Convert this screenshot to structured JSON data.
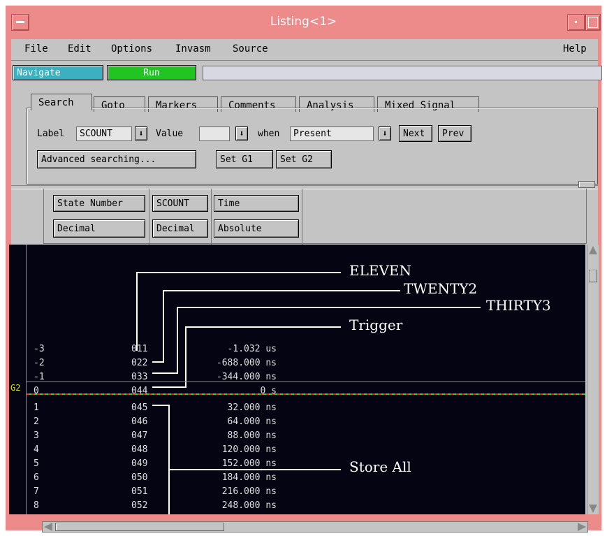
{
  "window": {
    "title": "Listing<1>"
  },
  "menubar": [
    "File",
    "Edit",
    "Options",
    "Invasm",
    "Source"
  ],
  "help_label": "Help",
  "toolbar": {
    "navigate": "Navigate",
    "run": "Run",
    "status": ""
  },
  "tabs": [
    "Search",
    "Goto",
    "Markers",
    "Comments",
    "Analysis",
    "Mixed Signal"
  ],
  "search": {
    "label_text": "Label",
    "label_value": "SCOUNT",
    "value_text": "Value",
    "value_value": "",
    "when_text": "when",
    "when_value": "Present",
    "next": "Next",
    "prev": "Prev",
    "advanced": "Advanced searching...",
    "set_g1": "Set G1",
    "set_g2": "Set G2",
    "arrow": "⬇"
  },
  "columns": [
    {
      "name": "State Number",
      "format": "Decimal"
    },
    {
      "name": "SCOUNT",
      "format": "Decimal"
    },
    {
      "name": "Time",
      "format": "Absolute"
    }
  ],
  "gutter_marker": "G2",
  "rows": [
    {
      "state": "-3",
      "scount": "011",
      "time": "-1.032 us"
    },
    {
      "state": "-2",
      "scount": "022",
      "time": "-688.000 ns"
    },
    {
      "state": "-1",
      "scount": "033",
      "time": "-344.000 ns"
    },
    {
      "state": "0",
      "scount": "044",
      "time": "0 s"
    },
    {
      "state": "1",
      "scount": "045",
      "time": "32.000 ns"
    },
    {
      "state": "2",
      "scount": "046",
      "time": "64.000 ns"
    },
    {
      "state": "3",
      "scount": "047",
      "time": "88.000 ns"
    },
    {
      "state": "4",
      "scount": "048",
      "time": "120.000 ns"
    },
    {
      "state": "5",
      "scount": "049",
      "time": "152.000 ns"
    },
    {
      "state": "6",
      "scount": "050",
      "time": "184.000 ns"
    },
    {
      "state": "7",
      "scount": "051",
      "time": "216.000 ns"
    },
    {
      "state": "8",
      "scount": "052",
      "time": "248.000 ns"
    }
  ],
  "annotations": [
    "ELEVEN",
    "TWENTY2",
    "THIRTY3",
    "Trigger",
    "Store All"
  ],
  "colors": {
    "titlebar": "#ed8a8a",
    "panel": "#c4c4c4",
    "navigate": "#3cb0c0",
    "run": "#22c422",
    "listing_bg": "#040412",
    "marker_green": "#22dd22",
    "marker_red": "#ee2222"
  }
}
